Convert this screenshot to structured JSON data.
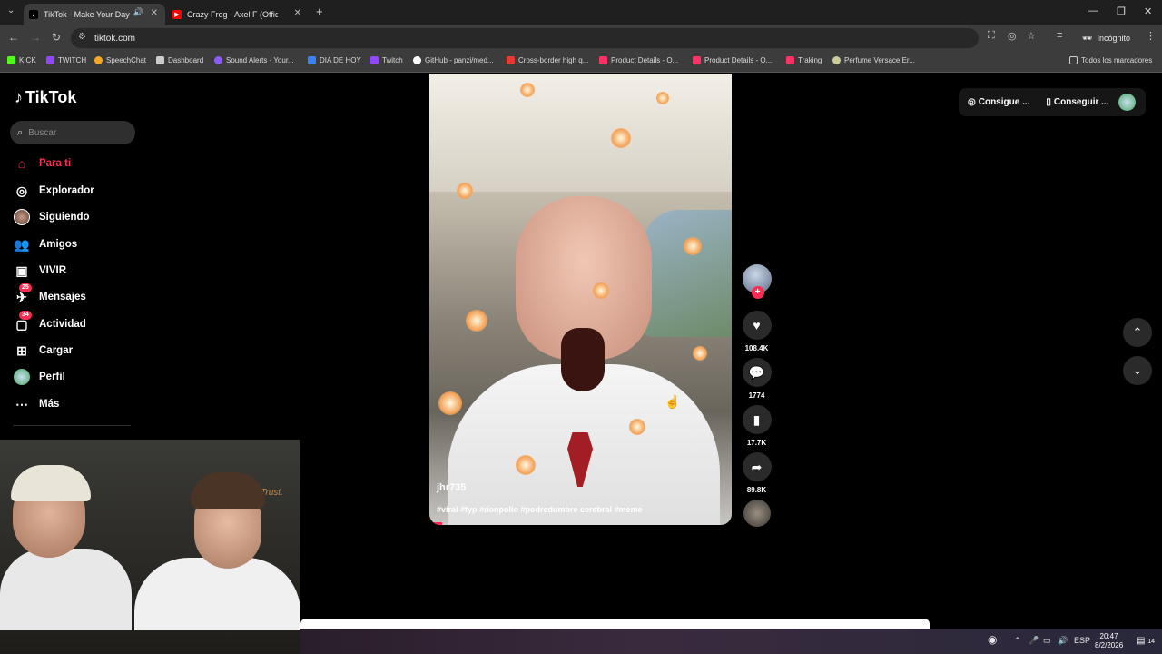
{
  "browser": {
    "tabs": [
      {
        "title": "TikTok - Make Your Day",
        "active": true,
        "icon": "tiktok-icon"
      },
      {
        "title": "Crazy Frog - Axel F (Official Vid",
        "active": false,
        "icon": "youtube-icon"
      }
    ],
    "new_tab_label": "+",
    "url": "tiktok.com",
    "incognito_label": "Incógnito",
    "bookmarks": [
      {
        "label": "KICK",
        "color": "#53fc18"
      },
      {
        "label": "TWITCH",
        "color": "#9146ff"
      },
      {
        "label": "SpeechChat",
        "color": "#f5a623"
      },
      {
        "label": "Dashboard",
        "color": "#cccccc"
      },
      {
        "label": "Sound Alerts - Your...",
        "color": "#8b5cf6"
      },
      {
        "label": "DIA DE HOY",
        "color": "#3b82f6"
      },
      {
        "label": "Twitch",
        "color": "#9146ff"
      },
      {
        "label": "GitHub - panzi/med...",
        "color": "#ffffff"
      },
      {
        "label": "Cross-border high q...",
        "color": "#e53935"
      },
      {
        "label": "Product Details - O...",
        "color": "#ff3366"
      },
      {
        "label": "Product Details - O...",
        "color": "#ff3366"
      },
      {
        "label": "Traking",
        "color": "#ff3366"
      },
      {
        "label": "Perfume Versace Er...",
        "color": "#cccc99"
      }
    ],
    "all_bookmarks_label": "Todos los marcadores"
  },
  "tiktok": {
    "logo_text": "TikTok",
    "search_placeholder": "Buscar",
    "nav": [
      {
        "label": "Para ti",
        "icon": "home-icon",
        "active": true,
        "badge": ""
      },
      {
        "label": "Explorador",
        "icon": "compass-icon",
        "active": false,
        "badge": ""
      },
      {
        "label": "Siguiendo",
        "icon": "following-avatar-icon",
        "active": false,
        "badge": ""
      },
      {
        "label": "Amigos",
        "icon": "friends-icon",
        "active": false,
        "badge": ""
      },
      {
        "label": "VIVIR",
        "icon": "live-icon",
        "active": false,
        "badge": ""
      },
      {
        "label": "Mensajes",
        "icon": "messages-icon",
        "active": false,
        "badge": "25"
      },
      {
        "label": "Actividad",
        "icon": "activity-icon",
        "active": false,
        "badge": "34"
      },
      {
        "label": "Cargar",
        "icon": "upload-icon",
        "active": false,
        "badge": ""
      },
      {
        "label": "Perfil",
        "icon": "profile-icon",
        "active": false,
        "badge": ""
      },
      {
        "label": "Más",
        "icon": "more-icon",
        "active": false,
        "badge": ""
      }
    ],
    "video": {
      "username": "jhr735",
      "caption": "#viral #fyp #donpollo #podredumbre cerebral #meme"
    },
    "actions": {
      "likes": "108.4K",
      "comments": "1774",
      "saves": "17.7K",
      "shares": "89.8K"
    },
    "top_right": {
      "coins_label": "Consigue ...",
      "app_label": "Conseguir ..."
    }
  },
  "webcam": {
    "sign_text": "Trust."
  },
  "taskbar": {
    "language": "ESP",
    "time": "20:47",
    "date": "8/2/2026",
    "notifications": "14"
  }
}
